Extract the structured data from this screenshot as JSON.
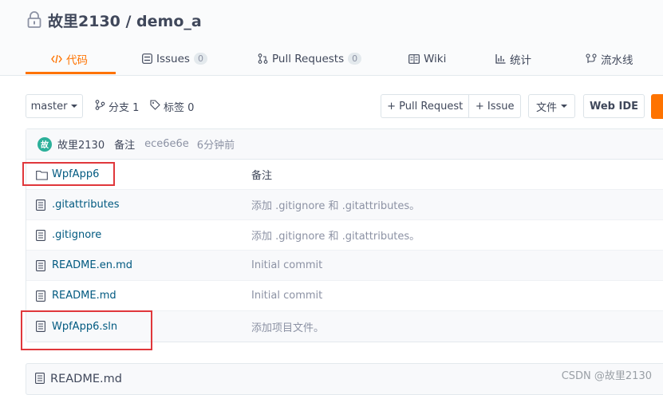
{
  "repo": {
    "title": "故里2130 / demo_a"
  },
  "tabs": [
    {
      "label": "代码",
      "icon": "code-icon",
      "active": true
    },
    {
      "label": "Issues",
      "icon": "issues-icon",
      "count": "0"
    },
    {
      "label": "Pull Requests",
      "icon": "pull-request-icon",
      "count": "0"
    },
    {
      "label": "Wiki",
      "icon": "book-icon"
    },
    {
      "label": "统计",
      "icon": "stats-icon"
    },
    {
      "label": "流水线",
      "icon": "pipeline-icon"
    }
  ],
  "toolbar": {
    "branch_select": "master",
    "branches_label": "分支 1",
    "tags_label": "标签 0",
    "pull_request_label": "+ Pull Request",
    "issue_label": "+ Issue",
    "file_menu_label": "文件",
    "web_ide_label": "Web IDE"
  },
  "commit": {
    "avatar_text": "故",
    "author": "故里2130",
    "message": "备注",
    "hash": "ece6e6e",
    "time": "6分钟前"
  },
  "files": [
    {
      "name": "WpfApp6",
      "type": "folder",
      "message": "备注"
    },
    {
      "name": ".gitattributes",
      "type": "file",
      "message": "添加 .gitignore 和 .gitattributes。"
    },
    {
      "name": ".gitignore",
      "type": "file",
      "message": "添加 .gitignore 和 .gitattributes。"
    },
    {
      "name": "README.en.md",
      "type": "file",
      "message": "Initial commit"
    },
    {
      "name": "README.md",
      "type": "file",
      "message": "Initial commit"
    },
    {
      "name": "WpfApp6.sln",
      "type": "file",
      "message": "添加项目文件。"
    }
  ],
  "readme": {
    "title": "README.md"
  },
  "watermark": "CSDN @故里2130",
  "colors": {
    "accent": "#fe7300",
    "link": "#005980",
    "highlight": "#e0373b"
  }
}
